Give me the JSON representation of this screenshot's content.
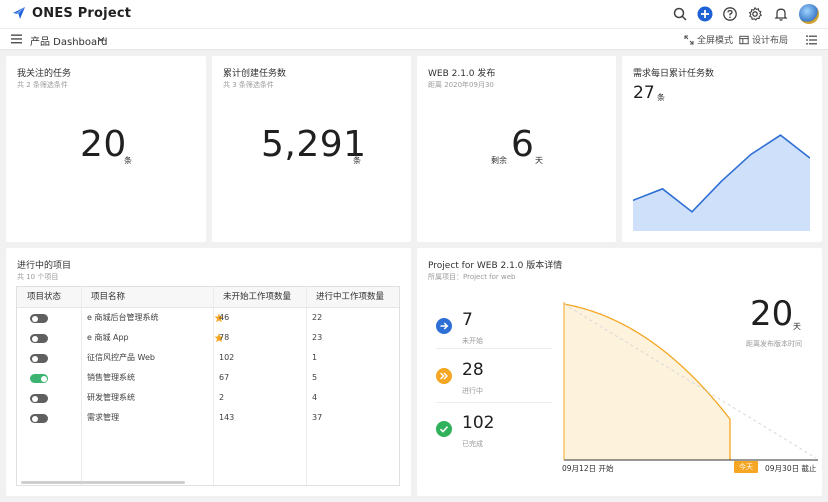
{
  "app": {
    "name": "ONES Project"
  },
  "subbar": {
    "dashboard": "产品 Dashboard",
    "fullscreen": "全屏模式",
    "layout": "设计布局"
  },
  "cards": {
    "focused": {
      "title": "我关注的任务",
      "sub": "共 2 条筛选条件",
      "value": "20",
      "unit": "条"
    },
    "created": {
      "title": "累计创建任务数",
      "sub": "共 3 条筛选条件",
      "value": "5,291",
      "unit": "条"
    },
    "release": {
      "title": "WEB 2.1.0 发布",
      "sub": "距离 2020年09月30",
      "prefix": "剩余",
      "value": "6",
      "unit": "天"
    },
    "daily": {
      "title": "需求每日累计任务数",
      "value": "27",
      "unit": "条"
    }
  },
  "chart_data": {
    "type": "area",
    "values": [
      8,
      11,
      5,
      13,
      20,
      25,
      19
    ],
    "ylim": [
      0,
      30
    ],
    "color": "#2d6fd4",
    "fill": "#cfe0fa"
  },
  "projects": {
    "title": "进行中的项目",
    "sub": "共 10 个项目",
    "columns": [
      "项目状态",
      "项目名称",
      "未开始工作项数量",
      "进行中工作项数量"
    ],
    "rows": [
      {
        "name": "e 商城后台管理系统",
        "todo": "46",
        "doing": "22",
        "on": false,
        "star": true
      },
      {
        "name": "e 商城 App",
        "todo": "78",
        "doing": "23",
        "on": false,
        "star": true
      },
      {
        "name": "征信风控产品 Web",
        "todo": "102",
        "doing": "1",
        "on": false,
        "star": false
      },
      {
        "name": "销售管理系统",
        "todo": "67",
        "doing": "5",
        "on": true,
        "star": false
      },
      {
        "name": "研发管理系统",
        "todo": "2",
        "doing": "4",
        "on": false,
        "star": false
      },
      {
        "name": "需求管理",
        "todo": "143",
        "doing": "37",
        "on": false,
        "star": false
      }
    ]
  },
  "release_detail": {
    "title": "Project for WEB 2.1.0 版本详情",
    "sub": "所属项目：Project for web",
    "stats": [
      {
        "value": "7",
        "label": "未开始",
        "color": "#2d6fd4",
        "icon": "arrow-right-icon"
      },
      {
        "value": "28",
        "label": "进行中",
        "color": "#f5a623",
        "icon": "fast-forward-icon"
      },
      {
        "value": "102",
        "label": "已完成",
        "color": "#2fb25b",
        "icon": "check-icon"
      }
    ],
    "days_left": "20",
    "days_unit": "天",
    "days_label": "距离发布版本时间",
    "start_label": "09月12日 开始",
    "end_label": "09月30日 截止",
    "today_label": "今天",
    "burndown": {
      "start": 137,
      "today": 35,
      "progress": 0.68
    }
  }
}
